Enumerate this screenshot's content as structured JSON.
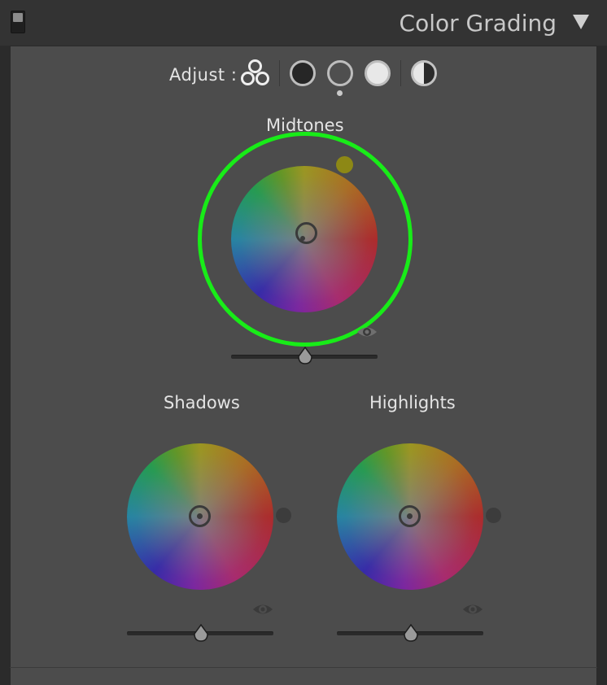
{
  "panel": {
    "title": "Color Grading"
  },
  "adjust": {
    "label": "Adjust :"
  },
  "wheels": {
    "midtones": {
      "label": "Midtones",
      "slider_value": 0.5
    },
    "shadows": {
      "label": "Shadows",
      "slider_value": 0.5
    },
    "highlights": {
      "label": "Highlights",
      "slider_value": 0.5
    }
  },
  "colors": {
    "highlight_ring": "#18ec18",
    "panel_bg": "#4c4c4c",
    "header_bg": "#333333",
    "hue_knob": "#8d8815"
  }
}
